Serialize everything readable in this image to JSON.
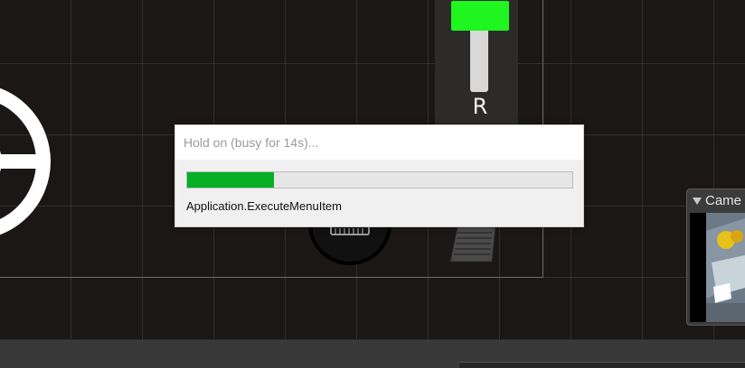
{
  "viewport": {
    "shifter": {
      "gear_label": "R",
      "knob_color": "#1ff51f"
    },
    "icons": [
      "steering-wheel-icon",
      "handbrake-icon",
      "pedal-icon"
    ]
  },
  "camera_panel": {
    "title": "Came",
    "toggle_icon": "triangle-down-icon"
  },
  "progress_dialog": {
    "title": "Hold on (busy for 14s)...",
    "status": "Application.ExecuteMenuItem",
    "progress": 0.225,
    "fill_color": "#06b025"
  }
}
